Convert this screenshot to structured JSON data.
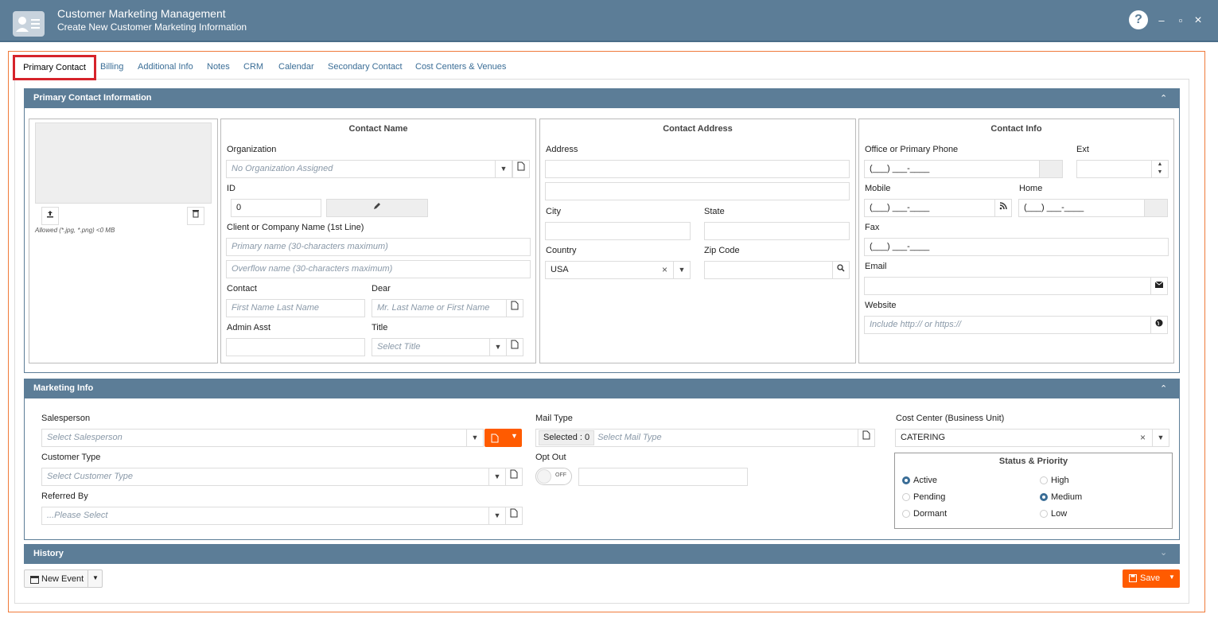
{
  "window": {
    "title": "Customer Marketing Management",
    "subtitle": "Create New Customer Marketing Information",
    "help_glyph": "?",
    "minimize_glyph": "–",
    "maximize_glyph": "▫",
    "close_glyph": "×"
  },
  "tabs": [
    "Primary Contact",
    "Billing",
    "Additional Info",
    "Notes",
    "CRM",
    "Calendar",
    "Secondary Contact",
    "Cost Centers & Venues"
  ],
  "primary_section": {
    "header": "Primary Contact Information",
    "photo": {
      "hint": "Allowed (*.jpg, *.png) <0 MB"
    },
    "contact_name": {
      "title": "Contact Name",
      "organization_label": "Organization",
      "organization_placeholder": "No Organization Assigned",
      "id_label": "ID",
      "id_value": "0",
      "client_label": "Client or Company Name (1st Line)",
      "primary_name_placeholder": "Primary name (30-characters maximum)",
      "overflow_name_placeholder": "Overflow name (30-characters maximum)",
      "contact_label": "Contact",
      "contact_placeholder": "First Name Last Name",
      "dear_label": "Dear",
      "dear_placeholder": "Mr. Last Name or First Name",
      "admin_label": "Admin Asst",
      "title_label": "Title",
      "title_placeholder": "Select Title"
    },
    "contact_address": {
      "title": "Contact Address",
      "address_label": "Address",
      "city_label": "City",
      "state_label": "State",
      "country_label": "Country",
      "country_value": "USA",
      "zip_label": "Zip Code"
    },
    "contact_info": {
      "title": "Contact Info",
      "office_label": "Office or Primary Phone",
      "office_value": "(___) ___-____",
      "ext_label": "Ext",
      "mobile_label": "Mobile",
      "mobile_value": "(___) ___-____",
      "home_label": "Home",
      "home_value": "(___) ___-____",
      "fax_label": "Fax",
      "fax_value": "(___) ___-____",
      "email_label": "Email",
      "website_label": "Website",
      "website_placeholder": "Include http:// or https://"
    }
  },
  "marketing_section": {
    "header": "Marketing Info",
    "salesperson_label": "Salesperson",
    "salesperson_placeholder": "Select Salesperson",
    "customer_type_label": "Customer Type",
    "customer_type_placeholder": "Select Customer Type",
    "referred_label": "Referred By",
    "referred_placeholder": "...Please Select",
    "mail_type_label": "Mail Type",
    "mail_selected": "Selected : 0",
    "mail_placeholder": "Select Mail Type",
    "opt_out_label": "Opt Out",
    "opt_out_state": "OFF",
    "cost_center_label": "Cost Center (Business Unit)",
    "cost_center_value": "CATERING",
    "status_title": "Status & Priority",
    "status_options": [
      {
        "label": "Active",
        "selected": true
      },
      {
        "label": "Pending",
        "selected": false
      },
      {
        "label": "Dormant",
        "selected": false
      }
    ],
    "priority_options": [
      {
        "label": "High",
        "selected": false
      },
      {
        "label": "Medium",
        "selected": true
      },
      {
        "label": "Low",
        "selected": false
      }
    ]
  },
  "history_section": {
    "header": "History"
  },
  "footer": {
    "new_event_label": "New Event",
    "save_label": "Save"
  },
  "colors": {
    "header": "#5c7d97",
    "accent": "#ff5b00",
    "tab_text": "#3a6d96",
    "highlight": "#d6232b"
  }
}
